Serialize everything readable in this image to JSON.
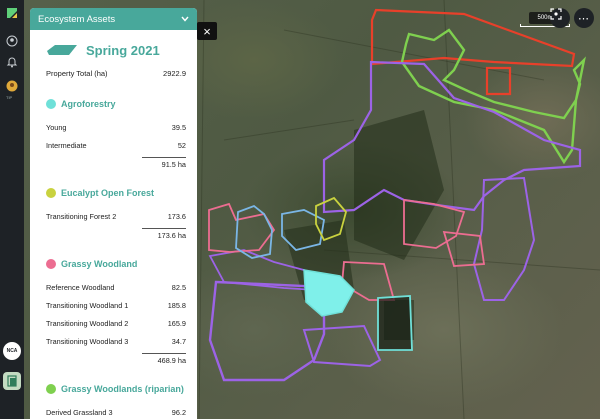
{
  "panel": {
    "title": "Ecosystem Assets",
    "season": "Spring 2021",
    "property_total_label": "Property Total (ha)",
    "property_total_value": "2922.9",
    "sections": [
      {
        "name": "Agroforestry",
        "color": "#6fe0d8",
        "rows": [
          {
            "label": "Young",
            "value": "39.5"
          },
          {
            "label": "Intermediate",
            "value": "52"
          }
        ],
        "subtotal": "91.5 ha"
      },
      {
        "name": "Eucalypt Open Forest",
        "color": "#c9d23f",
        "rows": [
          {
            "label": "Transitioning Forest 2",
            "value": "173.6"
          }
        ],
        "subtotal": "173.6 ha"
      },
      {
        "name": "Grassy Woodland",
        "color": "#ec6d91",
        "rows": [
          {
            "label": "Reference Woodland",
            "value": "82.5"
          },
          {
            "label": "Transitioning Woodland 1",
            "value": "185.8"
          },
          {
            "label": "Transitioning Woodland 2",
            "value": "165.9"
          },
          {
            "label": "Transitioning Woodland 3",
            "value": "34.7"
          }
        ],
        "subtotal": "468.9 ha"
      },
      {
        "name": "Grassy Woodlands (riparian)",
        "color": "#7fd04f",
        "rows": [
          {
            "label": "Derived Grassland 3",
            "value": "96.2"
          }
        ]
      }
    ]
  },
  "map": {
    "scale_label": "500m",
    "close_label": "×"
  },
  "sidebar": {
    "nca_label": "NCA",
    "small_label": "TIP"
  },
  "colors": {
    "accent": "#48a89b",
    "red": "#e8402a",
    "purple": "#9c63e6",
    "pink": "#ec6d91",
    "lime": "#7fd04f",
    "cyan": "#6fe0d8",
    "yellow": "#c9d23f",
    "blue": "#7ab6e6"
  }
}
